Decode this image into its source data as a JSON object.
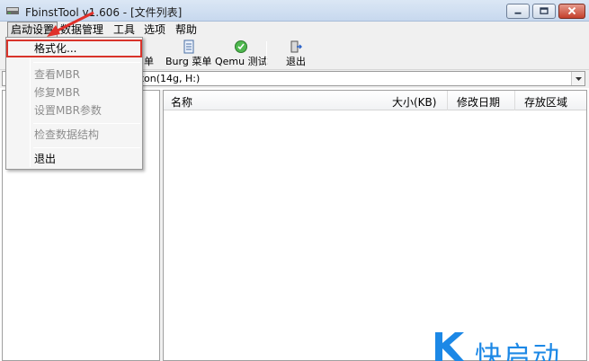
{
  "window": {
    "title": "FbinstTool v1.606 - [文件列表]"
  },
  "menubar": {
    "items": [
      "启动设置",
      "数据管理",
      "工具",
      "选项",
      "帮助"
    ]
  },
  "dropdown": {
    "format_label": "格式化...",
    "view_mbr": "查看MBR",
    "restore_mbr": "修复MBR",
    "set_mbr_params": "设置MBR参数",
    "check_structure": "检查数据结构",
    "exit": "退出"
  },
  "toolbar": {
    "partial_menu_label": "单",
    "burg_menu_label": "Burg 菜单",
    "qemu_test_label": "Qemu 测试",
    "exit_label": "退出"
  },
  "device": {
    "selected_partial": "ston(14g, H:)"
  },
  "file_list": {
    "columns": [
      "名称",
      "大小(KB)",
      "修改日期",
      "存放区域"
    ]
  },
  "watermark": {
    "text": "快启动"
  },
  "colors": {
    "highlight_border": "#d9342b",
    "watermark": "#1c88e6"
  }
}
